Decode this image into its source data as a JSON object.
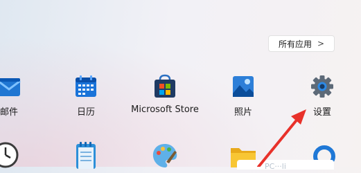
{
  "header": {
    "all_apps_label": "所有应用",
    "all_apps_chevron": ">"
  },
  "apps_row1": [
    {
      "label": "邮件",
      "icon": "mail-icon"
    },
    {
      "label": "日历",
      "icon": "calendar-icon"
    },
    {
      "label": "Microsoft Store",
      "icon": "store-icon"
    },
    {
      "label": "照片",
      "icon": "photos-icon"
    },
    {
      "label": "设置",
      "icon": "settings-icon"
    }
  ],
  "apps_row2": [
    {
      "icon": "clock-icon"
    },
    {
      "icon": "notepad-icon"
    },
    {
      "icon": "paint-icon"
    },
    {
      "icon": "folder-icon"
    },
    {
      "icon": "cortana-icon"
    }
  ],
  "tooltip_text": "PC···li",
  "colors": {
    "accent": "#0067c0",
    "arrow": "#e8312a"
  }
}
